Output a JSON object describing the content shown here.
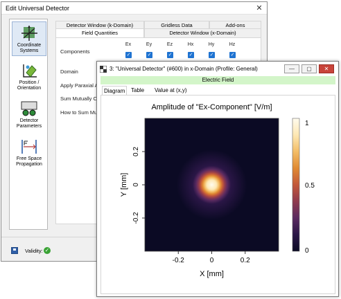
{
  "dialog": {
    "title": "Edit Universal Detector",
    "close_glyph": "✕",
    "sidebar": [
      {
        "label_lines": [
          "Coordinate",
          "Systems"
        ],
        "icon": "coordinate-systems-icon",
        "selected": true
      },
      {
        "label_lines": [
          "Position /",
          "Orientation"
        ],
        "icon": "position-orientation-icon",
        "selected": false
      },
      {
        "label_lines": [
          "Detector",
          "Parameters"
        ],
        "icon": "detector-parameters-icon",
        "selected": false
      },
      {
        "label_lines": [
          "Free Space",
          "Propagation"
        ],
        "icon": "free-space-propagation-icon",
        "selected": false
      }
    ],
    "tabs_row1": [
      "Detector Window (k-Domain)",
      "Gridless Data",
      "Add-ons"
    ],
    "tabs_row2": [
      "Field Quantities",
      "Detector Window (x-Domain)"
    ],
    "fields": {
      "components_label": "Components",
      "component_names": [
        "Ex",
        "Ey",
        "Ez",
        "Hx",
        "Hy",
        "Hz"
      ],
      "component_checked": [
        true,
        true,
        true,
        true,
        true,
        true
      ],
      "domain_label": "Domain",
      "paraxial_label": "Apply Paraxial Ap",
      "sum_label": "Sum Mutually Col",
      "how_sum_label": "How to Sum Mutu"
    },
    "status": {
      "validity_label": "Validity:",
      "validity_ok": true
    }
  },
  "window": {
    "title": "3: \"Universal Detector\" (#600) in x-Domain (Profile: General)",
    "band": "Electric Field",
    "tabs": [
      "Diagram",
      "Table",
      "Value at (x,y)"
    ],
    "active_tab": "Diagram",
    "buttons": {
      "minimize": "—",
      "maximize": "▢",
      "close": "✕"
    }
  },
  "chart_data": {
    "type": "heatmap",
    "title": "Amplitude of \"Ex-Component\"  [V/m]",
    "xlabel": "X [mm]",
    "ylabel": "Y [mm]",
    "xlim": [
      -0.4,
      0.4
    ],
    "ylim": [
      -0.4,
      0.4
    ],
    "xticks": [
      -0.2,
      0,
      0.2
    ],
    "xtick_labels": [
      "-0.2",
      "0",
      "0.2"
    ],
    "yticks": [
      -0.2,
      0,
      0.2
    ],
    "ytick_labels": [
      "-0.2",
      "0",
      "0.2"
    ],
    "peak_center": [
      0,
      0
    ],
    "beam_radius_mm": 0.1,
    "colorbar": {
      "min": 0,
      "max": 1,
      "ticks": [
        0,
        0.5,
        1
      ],
      "tick_labels": [
        "0",
        "0.5",
        "1"
      ]
    },
    "colormap": [
      "#0b0a24",
      "#2a1646",
      "#5a2a60",
      "#8f3a4e",
      "#c2583a",
      "#e08a33",
      "#f3bd67",
      "#fde8b4",
      "#fffbee"
    ]
  }
}
